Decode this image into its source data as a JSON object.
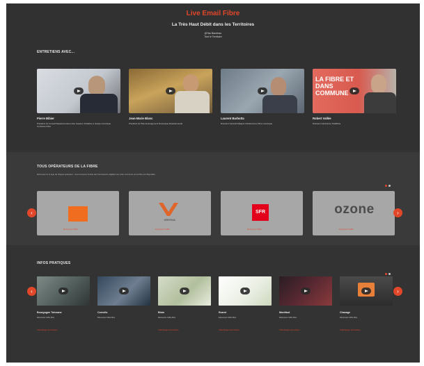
{
  "hero": {
    "title": "Live Email Fibre",
    "subtitle": "La Très Haut Débit dans les Territoires",
    "handle_line1": "@Tas Bandeau",
    "handle_line2": "Tout le Territoire"
  },
  "interviews": {
    "title": "ENTRETIENS AVEC...",
    "people": [
      {
        "name": "Pierre Bibier",
        "role": "Président du Conseil Départemental et des réseaux d'initiative à réseau numérique Territoires Fibre"
      },
      {
        "name": "Jean-Marie Blanc",
        "role": "Président du Pôle Aménagement Numérique Départemental"
      },
      {
        "name": "Laurent Barbotta",
        "role": "Directeur Général Délégué Infrastructure Fibre numérique"
      },
      {
        "name": "Robert Vallée",
        "role": "Directeur Général de TotalFibre"
      }
    ],
    "banner_text": "LA FIBRE ET DANS COMMUNE"
  },
  "operators": {
    "title": "TOUS OPÉRATEURS DE LA FIBRE",
    "description": "Retrouvez ici le logo de chaque opérateur ; vous trouverez la liste des fournisseurs éligibles sur votre commune sur la fibre est disponible",
    "cards": [
      {
        "logo": "orange",
        "cta": "Découvrir l'offre"
      },
      {
        "logo": "VERTEUIL",
        "cta": "Découvrir l'offre"
      },
      {
        "logo": "SFR",
        "cta": "Découvrir l'offre"
      },
      {
        "logo": "ozone",
        "cta": "Découvrir l'offre"
      }
    ]
  },
  "practical": {
    "title": "INFOS PRATIQUES",
    "items": [
      {
        "name": "Bourgogne Tolosane",
        "sub": "Découvrez l'offre fibre",
        "cta": "Télécharger la brochure"
      },
      {
        "name": "Cornelis",
        "sub": "Découvrez l'offre fibre",
        "cta": ""
      },
      {
        "name": "Bisto",
        "sub": "Découvrez l'offre fibre",
        "cta": "Télécharger la brochure"
      },
      {
        "name": "Ecarst",
        "sub": "Découvrez l'offre fibre",
        "cta": "Télécharger la brochure"
      },
      {
        "name": "Montfaut",
        "sub": "Découvrez l'offre fibre",
        "cta": "Télécharger la brochure"
      },
      {
        "name": "Chasage",
        "sub": "Découvrez l'offre fibre",
        "cta": "Télécharger la brochure"
      }
    ]
  },
  "colors": {
    "accent": "#e2472a",
    "background": "#333333"
  }
}
